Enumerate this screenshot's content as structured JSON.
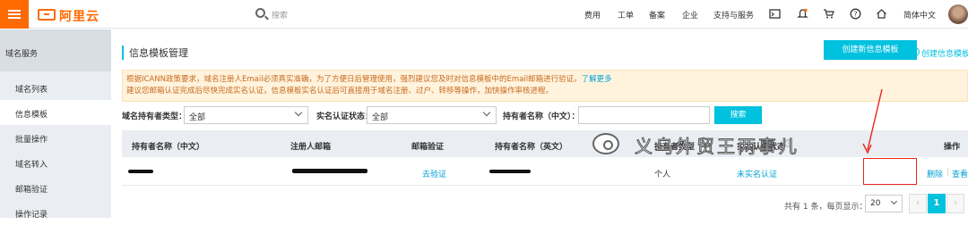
{
  "brand": {
    "name": "阿里云",
    "color": "#ff6a00"
  },
  "search": {
    "placeholder": "搜索"
  },
  "topnav": [
    {
      "label": "费用"
    },
    {
      "label": "工单"
    },
    {
      "label": "备案"
    },
    {
      "label": "企业"
    },
    {
      "label": "支持与服务"
    },
    {
      "label": "简体中文"
    }
  ],
  "topicons": [
    "terminal-icon",
    "bell-icon",
    "cart-icon",
    "help-icon",
    "home-icon",
    "user-avatar"
  ],
  "sidebar": {
    "title": "域名服务",
    "items": [
      {
        "label": "域名列表",
        "active": false
      },
      {
        "label": "信息模板",
        "active": true
      },
      {
        "label": "批量操作",
        "active": false
      },
      {
        "label": "域名转入",
        "active": false
      },
      {
        "label": "邮箱验证",
        "active": false
      },
      {
        "label": "操作记录",
        "active": false
      }
    ]
  },
  "main": {
    "title": "信息模板管理",
    "create_button": "创建新信息模板",
    "create_link": "创建信息模板",
    "notice": {
      "line1": "根据ICANN政策要求，域名注册人Email必须真实准确，为了方便日后管理使用，强烈建议您及时对信息模板中的Email邮箱进行验证。",
      "more_link": "了解更多",
      "line2": "建议您邮箱认证完成后尽快完成实名认证，信息模板实名认证后可直接用于域名注册、过户、转移等操作，加快操作审核进程。"
    },
    "filters": {
      "holder_type_label": "域名持有者类型：",
      "holder_type_value": "全部",
      "realname_label": "实名认证状态：",
      "realname_value": "全部",
      "holder_name_label": "持有者名称（中文）：",
      "holder_name_value": "",
      "search_button": "搜索"
    },
    "table": {
      "headers": [
        "持有者名称（中文）",
        "注册人邮箱",
        "邮箱验证",
        "持有者名称（英文）",
        "持有者类型",
        "实名认证状态",
        "操作"
      ],
      "rows": [
        {
          "name_cn": "",
          "email": "",
          "email_verify": "去验证",
          "name_en": "",
          "holder_type": "个人",
          "realname_status": "未实名认证",
          "actions": [
            "删除",
            "查看"
          ]
        }
      ]
    },
    "pager": {
      "total_text": "共有 1 条，每页显示：",
      "page_size": "20",
      "prev": "‹",
      "current": "1",
      "next": "›"
    }
  },
  "watermark": {
    "text": "义乌外贸王两事儿"
  },
  "accent": "#00c1de",
  "annotation_color": "#e8261d"
}
